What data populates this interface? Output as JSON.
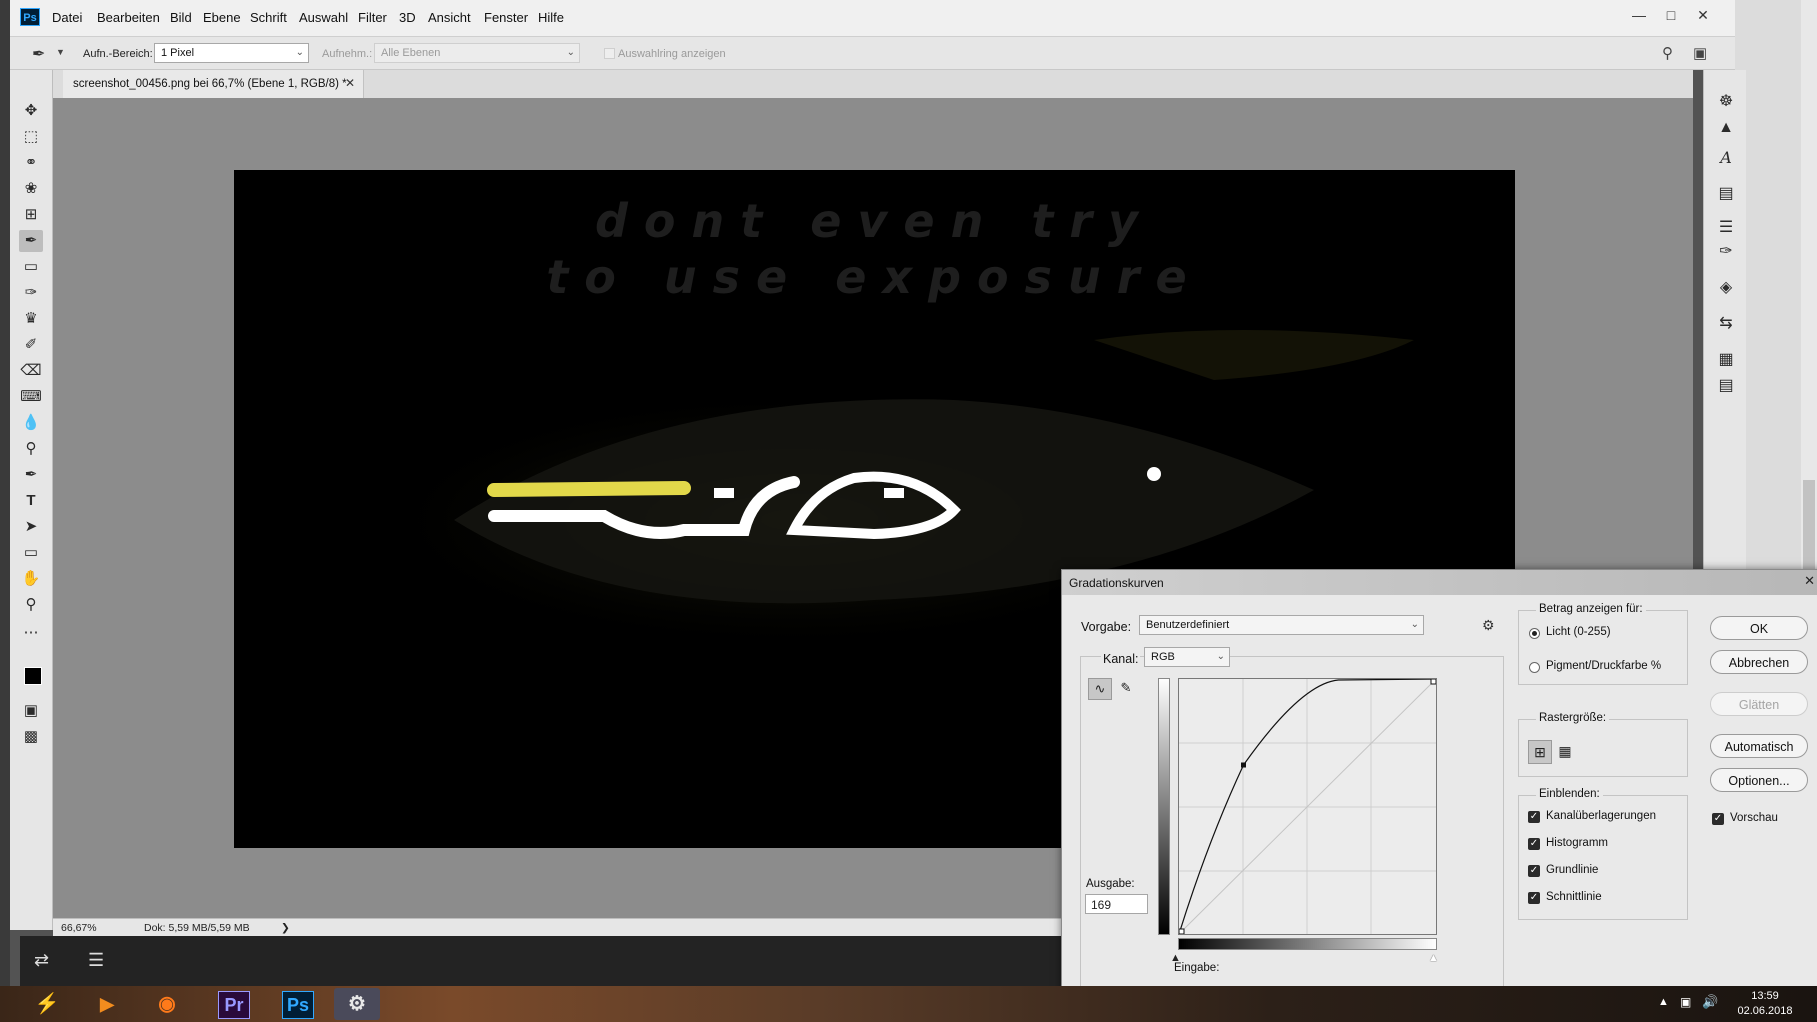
{
  "app": {
    "logo": "Ps",
    "menu": [
      "Datei",
      "Bearbeiten",
      "Bild",
      "Ebene",
      "Schrift",
      "Auswahl",
      "Filter",
      "3D",
      "Ansicht",
      "Fenster",
      "Hilfe"
    ]
  },
  "options_bar": {
    "sample_label": "Aufn.-Bereich:",
    "sample_value": "1 Pixel",
    "sample_layers_label": "Aufnehm.:",
    "sample_layers_value": "Alle Ebenen",
    "show_ring_label": "Auswahlring anzeigen"
  },
  "document": {
    "tab_label": "screenshot_00456.png bei 66,7% (Ebene 1, RGB/8) *",
    "canvas_text_line1": "dont even try",
    "canvas_text_line2": "to use exposure"
  },
  "status_bar": {
    "zoom": "66,67%",
    "doc_size": "Dok: 5,59 MB/5,59 MB"
  },
  "curves_dialog": {
    "title": "Gradationskurven",
    "preset_label": "Vorgabe:",
    "preset_value": "Benutzerdefiniert",
    "channel_label": "Kanal:",
    "channel_value": "RGB",
    "output_label": "Ausgabe:",
    "output_value": "169",
    "input_label": "Eingabe:",
    "buttons": {
      "ok": "OK",
      "cancel": "Abbrechen",
      "smooth": "Glätten",
      "auto": "Automatisch",
      "options": "Optionen..."
    },
    "preview_label": "Vorschau",
    "show_amount_label": "Betrag anzeigen für:",
    "light_option": "Licht (0-255)",
    "pigment_option": "Pigment/Druckfarbe %",
    "grid_size_label": "Rastergröße:",
    "show_label": "Einblenden:",
    "show_options": [
      "Kanalüberlagerungen",
      "Histogramm",
      "Grundlinie",
      "Schnittlinie"
    ],
    "curve_point": {
      "input": 64,
      "output": 169
    }
  },
  "taskbar": {
    "time": "13:59",
    "date": "02.06.2018",
    "apps": [
      "winamp-icon",
      "vlc-icon",
      "firefox-icon",
      "premiere-icon",
      "photoshop-icon",
      "steam-icon"
    ],
    "premiere_label": "Pr",
    "photoshop_label": "Ps"
  },
  "colors": {
    "ps_blue": "#31a8ff",
    "premiere_purple": "#9999ff"
  }
}
